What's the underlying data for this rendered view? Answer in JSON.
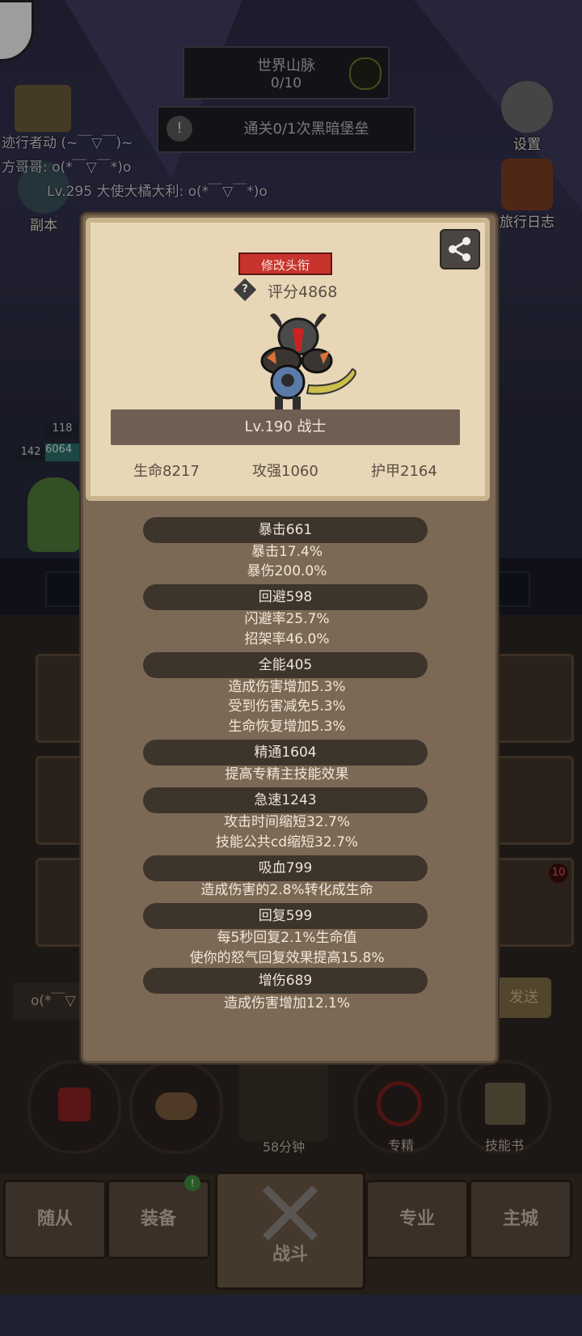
{
  "scene": {
    "zone_title": "世界山脉",
    "zone_progress": "0/10",
    "quest_text": "通关0/1次黑暗堡垒",
    "settings_label": "设置",
    "journal_label": "旅行日志",
    "dungeon_label": "副本",
    "chat": [
      "迹行者动 (~￣▽￣)~",
      "方哥哥: o(*￣▽￣*)o",
      "Lv.295 大使大橘大利: o(*￣▽￣*)o"
    ],
    "party_numbers": [
      "118",
      "142",
      "6064"
    ],
    "chat_input_placeholder": "o(*￣▽",
    "send_label": "发送",
    "chest_timer": "58分钟",
    "mastery_label": "专精",
    "skillbook_label": "技能书",
    "notify_badge": "10",
    "tabs": [
      "随从",
      "装备",
      "战斗",
      "专业",
      "主城"
    ]
  },
  "profile": {
    "edit_title_label": "修改头衔",
    "score": "评分4868",
    "level_class": "Lv.190 战士",
    "base_stats": [
      "生命8217",
      "攻强1060",
      "护甲2164"
    ]
  },
  "stat_groups": [
    {
      "head": "暴击661",
      "lines": [
        "暴击17.4%",
        "暴伤200.0%"
      ]
    },
    {
      "head": "回避598",
      "lines": [
        "闪避率25.7%",
        "招架率46.0%"
      ]
    },
    {
      "head": "全能405",
      "lines": [
        "造成伤害增加5.3%",
        "受到伤害减免5.3%",
        "生命恢复增加5.3%"
      ]
    },
    {
      "head": "精通1604",
      "lines": [
        "提高专精主技能效果"
      ]
    },
    {
      "head": "急速1243",
      "lines": [
        "攻击时间缩短32.7%",
        "技能公共cd缩短32.7%"
      ]
    },
    {
      "head": "吸血799",
      "lines": [
        "造成伤害的2.8%转化成生命"
      ]
    },
    {
      "head": "回复599",
      "lines": [
        "每5秒回复2.1%生命值",
        "使你的怒气回复效果提高15.8%"
      ]
    },
    {
      "head": "增伤689",
      "lines": [
        "造成伤害增加12.1%"
      ]
    }
  ],
  "colors": {
    "accent_red": "#c8332e",
    "panel_brown": "#7c6955",
    "card_parchment": "#e7d7b7"
  }
}
